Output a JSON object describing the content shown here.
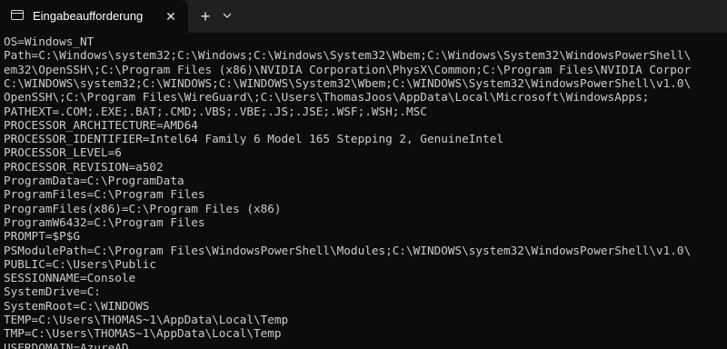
{
  "tab": {
    "title": "Eingabeaufforderung",
    "close_glyph": "✕",
    "new_tab_glyph": "+"
  },
  "console": {
    "lines": [
      "OS=Windows_NT",
      "Path=C:\\Windows\\system32;C:\\Windows;C:\\Windows\\System32\\Wbem;C:\\Windows\\System32\\WindowsPowerShell\\",
      "em32\\OpenSSH\\;C:\\Program Files (x86)\\NVIDIA Corporation\\PhysX\\Common;C:\\Program Files\\NVIDIA Corpor",
      "C:\\WINDOWS\\system32;C:\\WINDOWS;C:\\WINDOWS\\System32\\Wbem;C:\\WINDOWS\\System32\\WindowsPowerShell\\v1.0\\",
      "OpenSSH\\;C:\\Program Files\\WireGuard\\;C:\\Users\\ThomasJoos\\AppData\\Local\\Microsoft\\WindowsApps;",
      "PATHEXT=.COM;.EXE;.BAT;.CMD;.VBS;.VBE;.JS;.JSE;.WSF;.WSH;.MSC",
      "PROCESSOR_ARCHITECTURE=AMD64",
      "PROCESSOR_IDENTIFIER=Intel64 Family 6 Model 165 Stepping 2, GenuineIntel",
      "PROCESSOR_LEVEL=6",
      "PROCESSOR_REVISION=a502",
      "ProgramData=C:\\ProgramData",
      "ProgramFiles=C:\\Program Files",
      "ProgramFiles(x86)=C:\\Program Files (x86)",
      "ProgramW6432=C:\\Program Files",
      "PROMPT=$P$G",
      "PSModulePath=C:\\Program Files\\WindowsPowerShell\\Modules;C:\\WINDOWS\\system32\\WindowsPowerShell\\v1.0\\",
      "PUBLIC=C:\\Users\\Public",
      "SESSIONNAME=Console",
      "SystemDrive=C:",
      "SystemRoot=C:\\WINDOWS",
      "TEMP=C:\\Users\\THOMAS~1\\AppData\\Local\\Temp",
      "TMP=C:\\Users\\THOMAS~1\\AppData\\Local\\Temp",
      "USERDOMAIN=AzureAD"
    ]
  }
}
